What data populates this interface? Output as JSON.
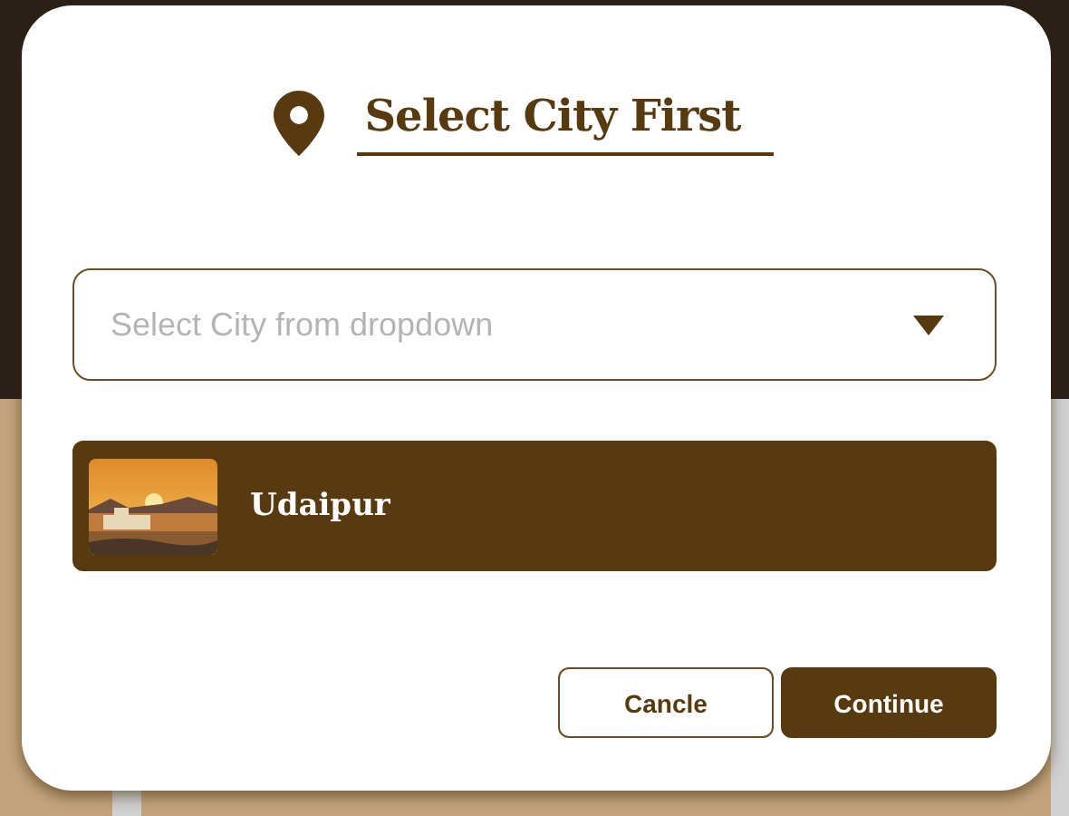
{
  "dialog": {
    "title": "Select City First"
  },
  "dropdown": {
    "placeholder": "Select City from dropdown"
  },
  "cities": [
    {
      "name": "Udaipur",
      "selected": true
    }
  ],
  "buttons": [
    {
      "label": "Cancle",
      "kind": "outline"
    },
    {
      "label": "Continue",
      "kind": "primary"
    }
  ]
}
